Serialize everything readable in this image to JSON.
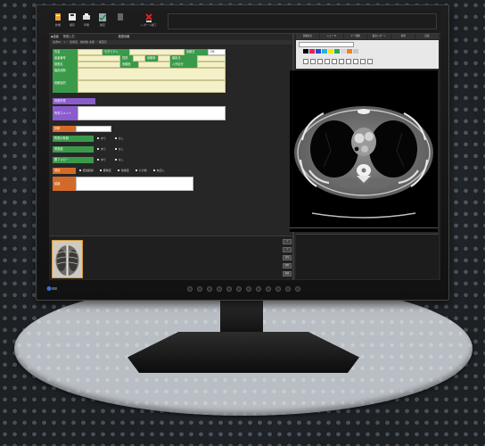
{
  "toolbar": {
    "buttons": [
      {
        "label": "新規",
        "icon": "new-record-icon"
      },
      {
        "label": "保存",
        "icon": "save-icon"
      },
      {
        "label": "印刷",
        "icon": "print-icon"
      },
      {
        "label": "確定",
        "icon": "confirm-check-icon"
      },
      {
        "label": "",
        "icon": "disabled-tool-icon"
      },
      {
        "label": "レポート終了",
        "icon": "close-report-icon"
      }
    ]
  },
  "menubar": {
    "items": [
      "◆患者",
      "所見入力",
      "検査情報"
    ]
  },
  "subinfo": "患者ID：1 ／ 患者名：放射線 太郎 ／ 検査日",
  "form": {
    "rows": [
      {
        "label": "氏名"
      },
      {
        "label": "患者番号"
      },
      {
        "label": "依頼科"
      },
      {
        "label": "検査名"
      },
      {
        "label": "依頼医"
      },
      {
        "label": "臨床診断"
      },
      {
        "label": "依頼目的"
      }
    ],
    "inline_labels": [
      "モダリティ",
      "依頼日",
      "性別",
      "撮影日",
      "入外区分"
    ],
    "ok_label": "OK",
    "section_purple": "検査所見",
    "purple_label": "所見コメント",
    "orange_label": "診断",
    "green_rows": [
      {
        "label": "所見の有無",
        "options": [
          "あり",
          "なし"
        ]
      },
      {
        "label": "緊急度",
        "options": [
          "あり",
          "なし"
        ]
      },
      {
        "label": "要フォロー",
        "options": [
          "あり",
          "なし"
        ]
      }
    ],
    "checks_label": "追加",
    "checks": [
      "経過観察",
      "要精査",
      "他検査",
      "その他",
      "未記入"
    ],
    "impression_label": "結論"
  },
  "side_buttons": [
    "↑",
    "↓",
    "追加",
    "削除",
    "編集"
  ],
  "right_tabs": [
    "画像表示",
    "シェーマ",
    "キー画像",
    "過去レポート",
    "参照",
    "比較"
  ],
  "colors": {
    "green_label": "#3a9a4a",
    "field_fill": "#f4f1c8",
    "purple": "#8a5ccc",
    "orange": "#d36a2a",
    "palette": [
      "#000000",
      "#e0245e",
      "#1e4fd8",
      "#2ab0e8",
      "#f2e600",
      "#2ea84a",
      "#d8d8d8",
      "#f08020",
      "#c8c8c8"
    ]
  },
  "image": {
    "description": "axial chest CT slice"
  }
}
